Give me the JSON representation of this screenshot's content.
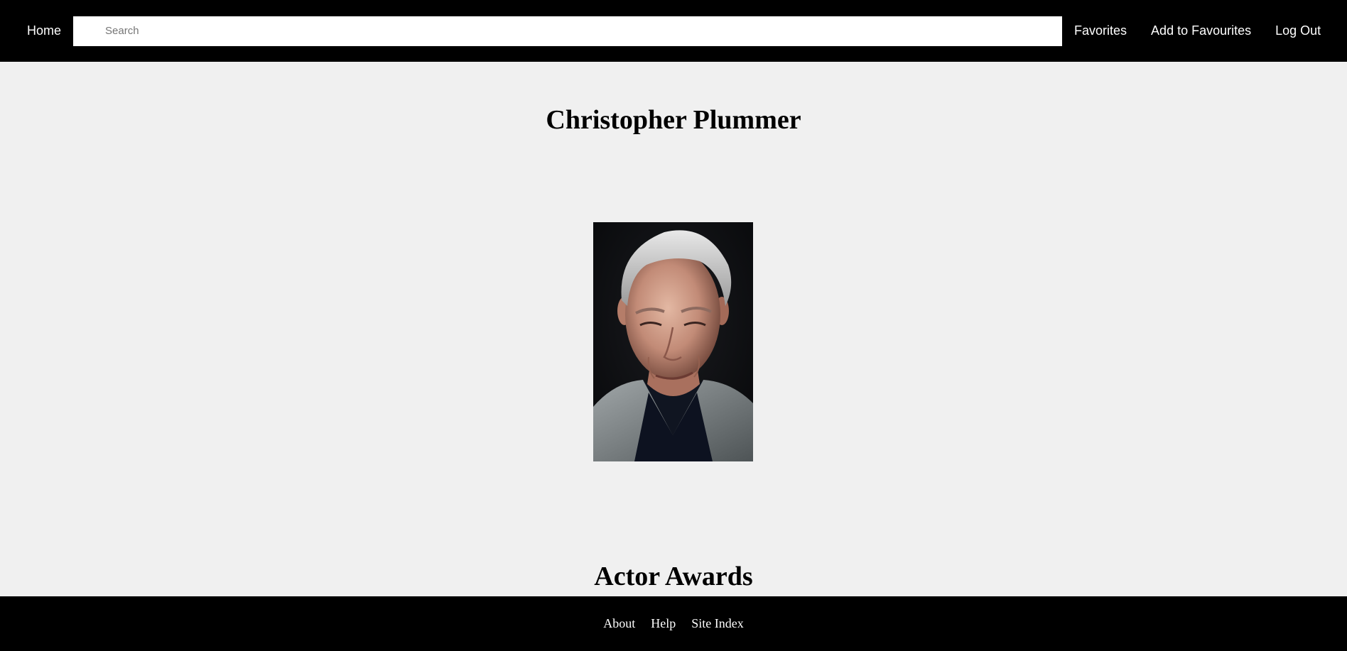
{
  "navbar": {
    "home_label": "Home",
    "search_placeholder": "Search",
    "links": {
      "favorites": "Favorites",
      "add_to_favourites": "Add to Favourites",
      "log_out": "Log Out"
    }
  },
  "main": {
    "actor_name": "Christopher Plummer",
    "portrait_image": "actor-portrait",
    "section_title": "Actor Awards"
  },
  "footer": {
    "links": [
      "About",
      "Help",
      "Site Index"
    ]
  },
  "colors": {
    "header_bg": "#000000",
    "page_bg": "#f0f0f0",
    "footer_bg": "#000000",
    "nav_text": "#ffffff"
  }
}
